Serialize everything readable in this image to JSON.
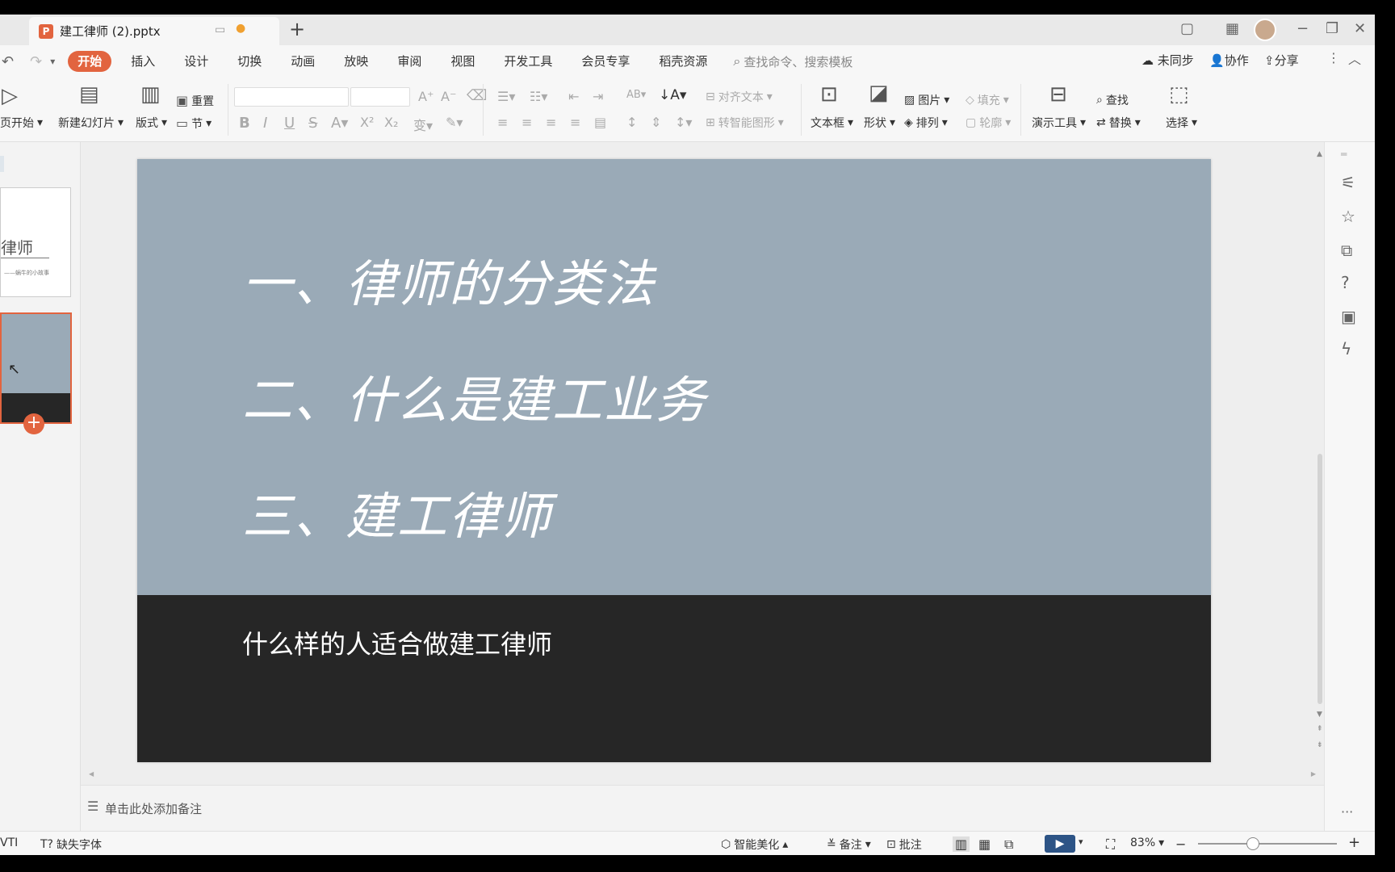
{
  "titlebar": {
    "tab_title": "建工律师 (2).pptx",
    "new_tab": "+"
  },
  "menubar": {
    "items": [
      "开始",
      "插入",
      "设计",
      "切换",
      "动画",
      "放映",
      "审阅",
      "视图",
      "开发工具",
      "会员专享",
      "稻壳资源"
    ],
    "search_placeholder": "查找命令、搜索模板",
    "sync": "未同步",
    "collab": "协作",
    "share": "分享"
  },
  "ribbon": {
    "from_start": "页开始",
    "new_slide": "新建幻灯片",
    "layout": "版式",
    "reset": "重置",
    "section": "节",
    "align_text": "对齐文本",
    "smart_shape": "转智能图形",
    "textbox": "文本框",
    "shape": "形状",
    "picture": "图片",
    "arrange": "排列",
    "fill": "填充",
    "outline": "轮廓",
    "present_tools": "演示工具",
    "find": "查找",
    "replace": "替换",
    "select": "选择"
  },
  "thumb1": {
    "title": "律师",
    "sub": "——蜗牛的小故事"
  },
  "slide": {
    "line1": "一、律师的分类法",
    "line2": "二、什么是建工业务",
    "line3": "三、建工律师",
    "subtitle": "什么样的人适合做建工律师",
    "bg_color": "#9aaab7",
    "dark_color": "#262626"
  },
  "notes": {
    "placeholder": "单击此处添加备注"
  },
  "status": {
    "font_label": "VTI",
    "missing_font": "缺失字体",
    "beautify": "智能美化",
    "notes": "备注",
    "comments": "批注",
    "zoom": "83%"
  }
}
